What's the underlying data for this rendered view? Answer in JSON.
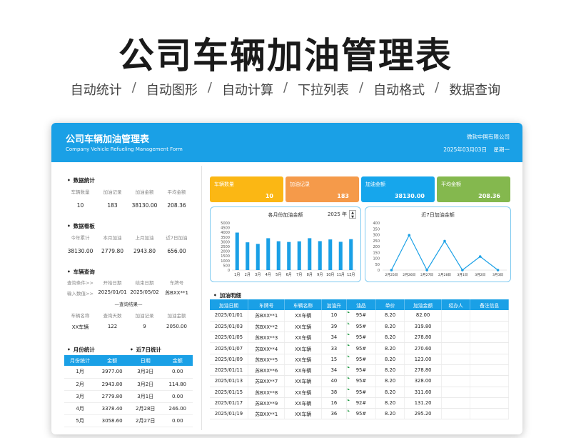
{
  "hero": {
    "title": "公司车辆加油管理表",
    "features": [
      "自动统计",
      "自动图形",
      "自动计算",
      "下拉列表",
      "自动格式",
      "数据查询"
    ],
    "separator": "/"
  },
  "header": {
    "title": "公司车辆加油管理表",
    "subtitle": "Company Vehicle Refueling Management Form",
    "company": "微软中国有限公司",
    "date": "2025年03月03日",
    "weekday": "星期一"
  },
  "stats": {
    "title": "数据统计",
    "headers": [
      "车辆数量",
      "加油记录",
      "加油金额",
      "平均金额"
    ],
    "values": [
      "10",
      "183",
      "38130.00",
      "208.36"
    ]
  },
  "board": {
    "title": "数据看板",
    "headers": [
      "今年累计",
      "本月加油",
      "上月加油",
      "近7日加油"
    ],
    "values": [
      "38130.00",
      "2779.80",
      "2943.80",
      "656.00"
    ]
  },
  "query": {
    "title": "车辆查询",
    "headers": [
      "查询条件>>",
      "开始日期",
      "结束日期",
      "车牌号"
    ],
    "inputs": [
      "输入数值>>",
      "2025/01/01",
      "2025/05/02",
      "苏BXX**1"
    ],
    "result_label": "—查询结果—",
    "result_headers": [
      "车辆名称",
      "查询天数",
      "加油记录",
      "加油金额"
    ],
    "result_values": [
      "XX车辆",
      "122",
      "9",
      "2050.00"
    ]
  },
  "monthly": {
    "title": "月份统计",
    "headers": [
      "月份统计",
      "金额"
    ],
    "rows": [
      [
        "1月",
        "3977.00"
      ],
      [
        "2月",
        "2943.80"
      ],
      [
        "3月",
        "2779.80"
      ],
      [
        "4月",
        "3378.40"
      ],
      [
        "5月",
        "3058.60"
      ]
    ]
  },
  "recent7": {
    "title": "近7日统计",
    "headers": [
      "日期",
      "金额"
    ],
    "rows": [
      [
        "3月3日",
        "0.00"
      ],
      [
        "3月2日",
        "114.80"
      ],
      [
        "3月1日",
        "0.00"
      ],
      [
        "2月28日",
        "246.00"
      ],
      [
        "2月27日",
        "0.00"
      ]
    ]
  },
  "kpis": [
    {
      "label": "车辆数量",
      "value": "10",
      "color": "#fbb714"
    },
    {
      "label": "加油记录",
      "value": "183",
      "color": "#f59a4a"
    },
    {
      "label": "加油金额",
      "value": "38130.00",
      "color": "#16a6ec"
    },
    {
      "label": "平均金额",
      "value": "208.36",
      "color": "#84b84e"
    }
  ],
  "charts": {
    "monthly": {
      "title": "各月份加油金额",
      "year": "2025 年",
      "spin_up": "▲",
      "spin_down": "▼"
    },
    "recent": {
      "title": "近7日加油金额"
    }
  },
  "chart_data": [
    {
      "type": "bar",
      "title": "各月份加油金额",
      "categories": [
        "1月",
        "2月",
        "3月",
        "4月",
        "5月",
        "6月",
        "7月",
        "8月",
        "9月",
        "10月",
        "11月",
        "12月"
      ],
      "values": [
        3977,
        2944,
        2780,
        3378,
        3059,
        2980,
        3050,
        3380,
        3070,
        3250,
        3000,
        3280
      ],
      "ylim": [
        0,
        5000
      ],
      "yticks": [
        "0",
        "500",
        "1000",
        "1500",
        "2000",
        "2500",
        "3000",
        "3500",
        "4000",
        "4500",
        "5000"
      ],
      "color": "#1aa0e6"
    },
    {
      "type": "line",
      "title": "近7日加油金额",
      "categories": [
        "2月25日",
        "2月26日",
        "2月27日",
        "2月28日",
        "3月1日",
        "3月2日",
        "3月3日"
      ],
      "values": [
        0,
        296,
        0,
        246,
        0,
        114.8,
        0
      ],
      "ylim": [
        0,
        400
      ],
      "yticks": [
        "0",
        "50",
        "100",
        "150",
        "200",
        "250",
        "300",
        "350",
        "400"
      ],
      "color": "#1aa0e6"
    }
  ],
  "detail": {
    "title": "加油明细",
    "headers": [
      "加油日期",
      "车牌号",
      "车辆名称",
      "加油升",
      "油品",
      "单价",
      "加油金额",
      "经办人",
      "备注信息"
    ],
    "rows": [
      [
        "2025/01/01",
        "苏BXX**1",
        "XX车辆",
        "10",
        "95#",
        "8.20",
        "82.00",
        "",
        ""
      ],
      [
        "2025/01/03",
        "苏BXX**2",
        "XX车辆",
        "39",
        "95#",
        "8.20",
        "319.80",
        "",
        ""
      ],
      [
        "2025/01/05",
        "苏BXX**3",
        "XX车辆",
        "34",
        "95#",
        "8.20",
        "278.80",
        "",
        ""
      ],
      [
        "2025/01/07",
        "苏BXX**4",
        "XX车辆",
        "33",
        "95#",
        "8.20",
        "270.60",
        "",
        ""
      ],
      [
        "2025/01/09",
        "苏BXX**5",
        "XX车辆",
        "15",
        "95#",
        "8.20",
        "123.00",
        "",
        ""
      ],
      [
        "2025/01/11",
        "苏BXX**6",
        "XX车辆",
        "34",
        "95#",
        "8.20",
        "278.80",
        "",
        ""
      ],
      [
        "2025/01/13",
        "苏BXX**7",
        "XX车辆",
        "40",
        "95#",
        "8.20",
        "328.00",
        "",
        ""
      ],
      [
        "2025/01/15",
        "苏BXX**8",
        "XX车辆",
        "38",
        "95#",
        "8.20",
        "311.60",
        "",
        ""
      ],
      [
        "2025/01/17",
        "苏BXX**9",
        "XX车辆",
        "16",
        "92#",
        "8.20",
        "131.20",
        "",
        ""
      ],
      [
        "2025/01/19",
        "苏BXX**1",
        "XX车辆",
        "36",
        "95#",
        "8.20",
        "295.20",
        "",
        ""
      ]
    ]
  }
}
